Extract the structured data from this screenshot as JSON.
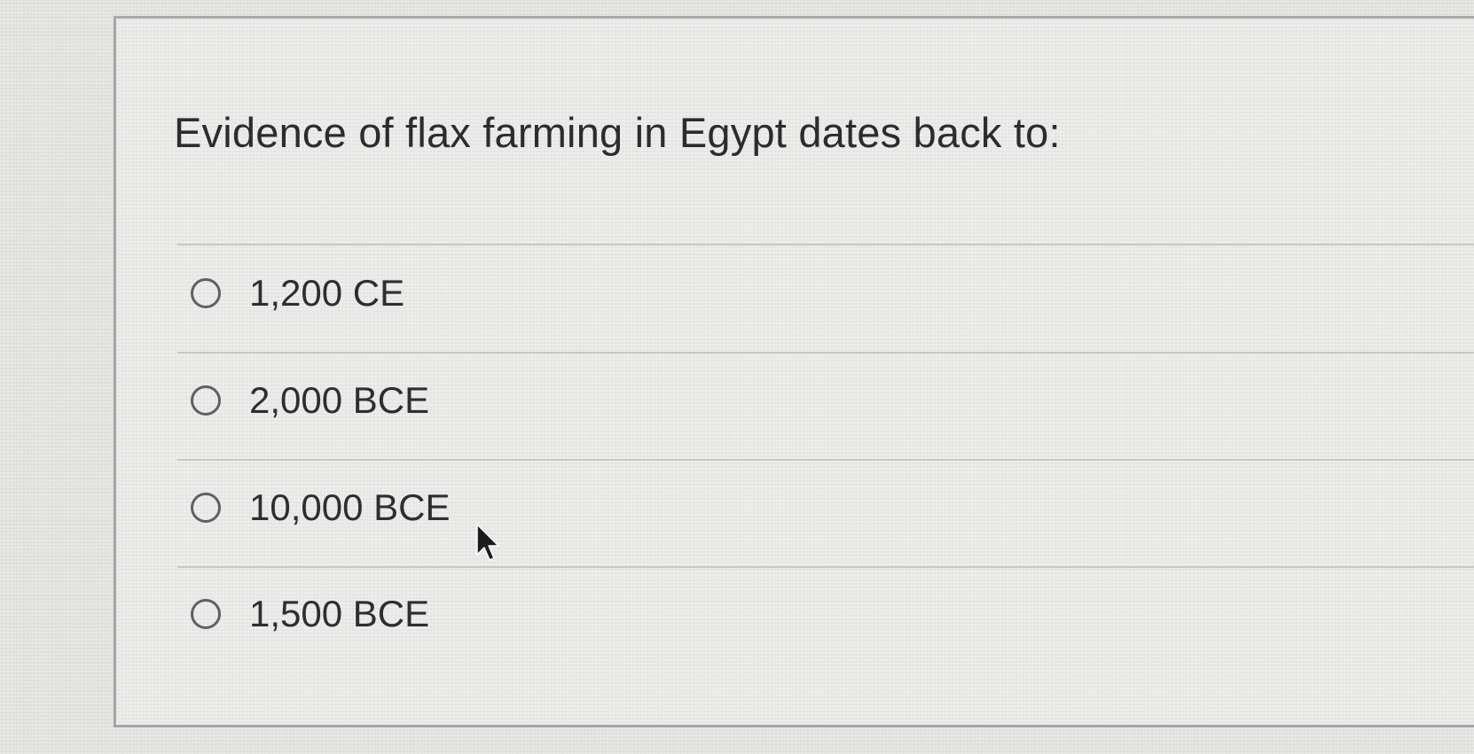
{
  "question": {
    "text": "Evidence of flax farming in Egypt dates back to:"
  },
  "options": [
    {
      "label": "1,200 CE",
      "selected": false
    },
    {
      "label": "2,000 BCE",
      "selected": false
    },
    {
      "label": "10,000 BCE",
      "selected": false
    },
    {
      "label": "1,500 BCE",
      "selected": false
    }
  ],
  "icons": {
    "cursor": "mouse-pointer-icon"
  },
  "colors": {
    "background": "#e9eae7",
    "text": "#2b2c2f",
    "radio_border": "#5e6063",
    "divider": "#c6c8c6"
  }
}
